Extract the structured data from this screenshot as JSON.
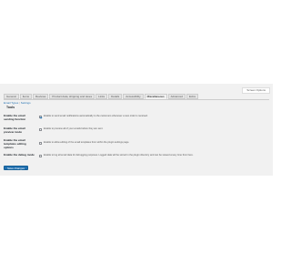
{
  "screen_options": {
    "label": "Screen Options"
  },
  "tabs": [
    {
      "label": "General"
    },
    {
      "label": "Items"
    },
    {
      "label": "Reviews"
    },
    {
      "label": "Product data, shipping and taxes"
    },
    {
      "label": "Links"
    },
    {
      "label": "Details"
    },
    {
      "label": "Accessibility"
    },
    {
      "label": "Miscellaneous"
    },
    {
      "label": "Advanced"
    },
    {
      "label": "Extra"
    }
  ],
  "subnav": {
    "first": "Email Types",
    "second": "Settings"
  },
  "section": {
    "title": "Tools"
  },
  "settings": [
    {
      "label": "Enable the email sending function",
      "checked": true,
      "description": "Enable to send email notifications automatically to the customers whenever a new order is received."
    },
    {
      "label": "Enable the email preview mode",
      "checked": false,
      "description": "Enable to preview all of your emails before they are sent."
    },
    {
      "label": "Enable the email templates editing options",
      "checked": false,
      "description": "Enable to allow editing of the email templates from within the plugin settings page."
    },
    {
      "label": "Enable the debug mode",
      "checked": false,
      "description": "Enable to log all email data for debugging purposes. Logged data will be stored in the plugin directory and can be viewed at any time from here."
    }
  ],
  "save_label": "Save changes"
}
